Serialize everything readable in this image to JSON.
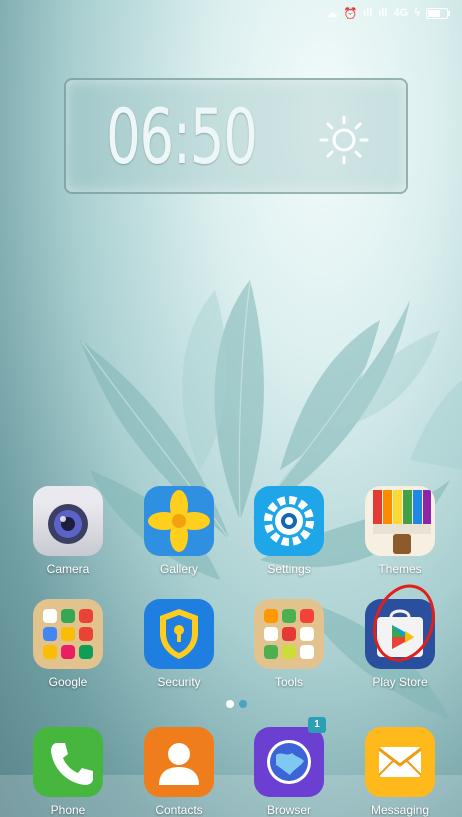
{
  "status_bar": {
    "network": "4G",
    "signal_text_1": "᯾",
    "signal_text_2": "ıll",
    "battery_level": 0.75
  },
  "clock_widget": {
    "time": "06:50",
    "weather_icon": "sun-icon"
  },
  "home_rows": [
    [
      {
        "label": "Camera",
        "icon": "camera-icon"
      },
      {
        "label": "Gallery",
        "icon": "gallery-icon"
      },
      {
        "label": "Settings",
        "icon": "settings-gear-icon"
      },
      {
        "label": "Themes",
        "icon": "themes-brush-icon"
      }
    ],
    [
      {
        "label": "Google",
        "icon": "google-folder-icon"
      },
      {
        "label": "Security",
        "icon": "security-shield-icon"
      },
      {
        "label": "Tools",
        "icon": "tools-folder-icon"
      },
      {
        "label": "Play Store",
        "icon": "play-store-icon"
      }
    ]
  ],
  "dock": [
    {
      "label": "Phone",
      "icon": "phone-icon"
    },
    {
      "label": "Contacts",
      "icon": "contacts-icon"
    },
    {
      "label": "Browser",
      "icon": "browser-globe-icon",
      "badge": "1"
    },
    {
      "label": "Messaging",
      "icon": "messaging-envelope-icon"
    }
  ],
  "pager": {
    "pages": 2,
    "current": 1
  },
  "colors": {
    "annotation_circle": "#e0201b",
    "badge": "#2b9fb3",
    "pager_active": "#4aa3c0",
    "pager_inactive": "#ffffff"
  }
}
